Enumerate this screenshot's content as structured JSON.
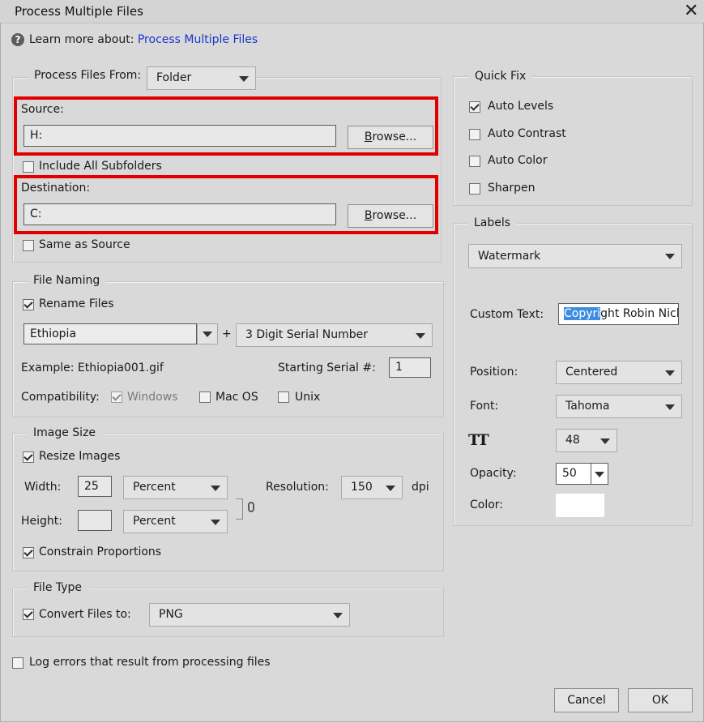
{
  "window": {
    "title": "Process Multiple Files",
    "close": "✕"
  },
  "help": {
    "prefix": "Learn more about:",
    "link": "Process Multiple Files",
    "icon": "?"
  },
  "process_from": {
    "label": "Process Files From:",
    "value": "Folder"
  },
  "source": {
    "label": "Source:",
    "value": "H:",
    "browse": "Browse..."
  },
  "include_subfolders": {
    "label": "Include All Subfolders",
    "checked": false
  },
  "destination": {
    "label": "Destination:",
    "value": "C:",
    "browse": "Browse..."
  },
  "same_as_source": {
    "label": "Same as Source",
    "checked": false
  },
  "file_naming": {
    "legend": "File Naming",
    "rename": {
      "label": "Rename Files",
      "checked": true
    },
    "name_value": "Ethiopia",
    "plus": "+",
    "serial_type": "3 Digit Serial Number",
    "example": "Example: Ethiopia001.gif",
    "starting_serial_label": "Starting Serial #:",
    "starting_serial_value": "1",
    "compat_label": "Compatibility:",
    "windows": {
      "label": "Windows",
      "checked": true
    },
    "macos": {
      "label": "Mac OS",
      "checked": false
    },
    "unix": {
      "label": "Unix",
      "checked": false
    }
  },
  "image_size": {
    "legend": "Image Size",
    "resize": {
      "label": "Resize Images",
      "checked": true
    },
    "width_label": "Width:",
    "width_value": "25",
    "width_unit": "Percent",
    "height_label": "Height:",
    "height_value": "",
    "height_unit": "Percent",
    "resolution_label": "Resolution:",
    "resolution_value": "150",
    "resolution_unit": "dpi",
    "constrain": {
      "label": "Constrain Proportions",
      "checked": true
    }
  },
  "file_type": {
    "legend": "File Type",
    "convert": {
      "label": "Convert Files to:",
      "checked": true
    },
    "format": "PNG"
  },
  "log_errors": {
    "label": "Log errors that result from processing files",
    "checked": false
  },
  "quick_fix": {
    "legend": "Quick Fix",
    "auto_levels": {
      "label": "Auto Levels",
      "checked": true
    },
    "auto_contrast": {
      "label": "Auto Contrast",
      "checked": false
    },
    "auto_color": {
      "label": "Auto Color",
      "checked": false
    },
    "sharpen": {
      "label": "Sharpen",
      "checked": false
    }
  },
  "labels": {
    "legend": "Labels",
    "type": "Watermark",
    "custom_text_label": "Custom Text:",
    "custom_text_selected": "Copyri",
    "custom_text_rest": "ght Robin Nich",
    "position_label": "Position:",
    "position_value": "Centered",
    "font_label": "Font:",
    "font_value": "Tahoma",
    "size_icon": "TT",
    "size_value": "48",
    "opacity_label": "Opacity:",
    "opacity_value": "50",
    "color_label": "Color:",
    "color_value": "#ffffff"
  },
  "buttons": {
    "cancel": "Cancel",
    "ok": "OK"
  },
  "colors": {
    "highlight": "#e00000",
    "link": "#1a35cc",
    "selection": "#3d8ee0"
  }
}
